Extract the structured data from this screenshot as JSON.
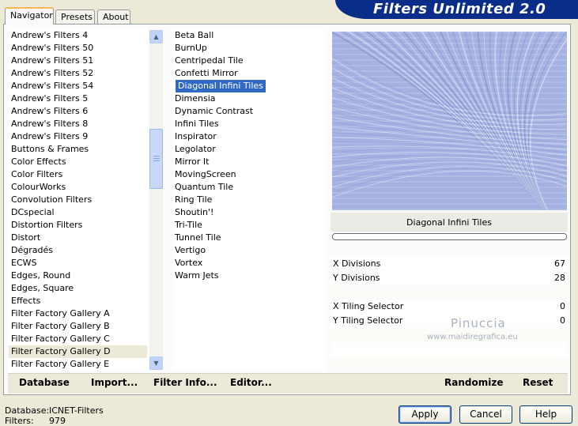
{
  "app": {
    "title": "Filters Unlimited 2.0"
  },
  "tabs": [
    {
      "label": "Navigator",
      "active": true
    },
    {
      "label": "Presets",
      "active": false
    },
    {
      "label": "About",
      "active": false
    }
  ],
  "categories": {
    "items": [
      "Andrew's Filters 4",
      "Andrew's Filters 50",
      "Andrew's Filters 51",
      "Andrew's Filters 52",
      "Andrew's Filters 54",
      "Andrew's Filters 5",
      "Andrew's Filters 6",
      "Andrew's Filters 8",
      "Andrew's Filters 9",
      "Buttons & Frames",
      "Color Effects",
      "Color Filters",
      "ColourWorks",
      "Convolution Filters",
      "DCspecial",
      "Distortion Filters",
      "Distort",
      "Dégradés",
      "ECWS",
      "Edges, Round",
      "Edges, Square",
      "Effects",
      "Filter Factory Gallery A",
      "Filter Factory Gallery B",
      "Filter Factory Gallery C",
      "Filter Factory Gallery D",
      "Filter Factory Gallery E"
    ],
    "selected": "Filter Factory Gallery D"
  },
  "filters": {
    "items": [
      "Beta Ball",
      "BurnUp",
      "Centripedal Tile",
      "Confetti Mirror",
      "Diagonal Infini Tiles",
      "Dimensia",
      "Dynamic Contrast",
      "Infini Tiles",
      "Inspirator",
      "Legolator",
      "Mirror It",
      "MovingScreen",
      "Quantum Tile",
      "Ring Tile",
      "Shoutin'!",
      "Tri-Tile",
      "Tunnel Tile",
      "Vertigo",
      "Vortex",
      "Warm Jets"
    ],
    "selected": "Diagonal Infini Tiles"
  },
  "preview": {
    "filter_name": "Diagonal Infini Tiles",
    "tint": "#a5b2e1"
  },
  "params": [
    {
      "label": "X Divisions",
      "value": "67"
    },
    {
      "label": "Y Divisions",
      "value": "28"
    },
    {
      "label": "X Tiling Selector",
      "value": "0"
    },
    {
      "label": "Y Tiling Selector",
      "value": "0"
    }
  ],
  "watermark": {
    "name": "Pinuccia",
    "site": "www.maidiregrafica.eu"
  },
  "toolbar": {
    "database": "Database",
    "import": "Import...",
    "filter_info": "Filter Info...",
    "editor": "Editor...",
    "randomize": "Randomize",
    "reset": "Reset"
  },
  "footer": {
    "database_label": "Database:",
    "database_value": "ICNET-Filters",
    "filters_label": "Filters:",
    "filters_value": "979",
    "apply": "Apply",
    "cancel": "Cancel",
    "help": "Help"
  },
  "colors": {
    "banner": "#0a2d8a",
    "selection": "#316ac5",
    "window": "#ece9d8"
  }
}
